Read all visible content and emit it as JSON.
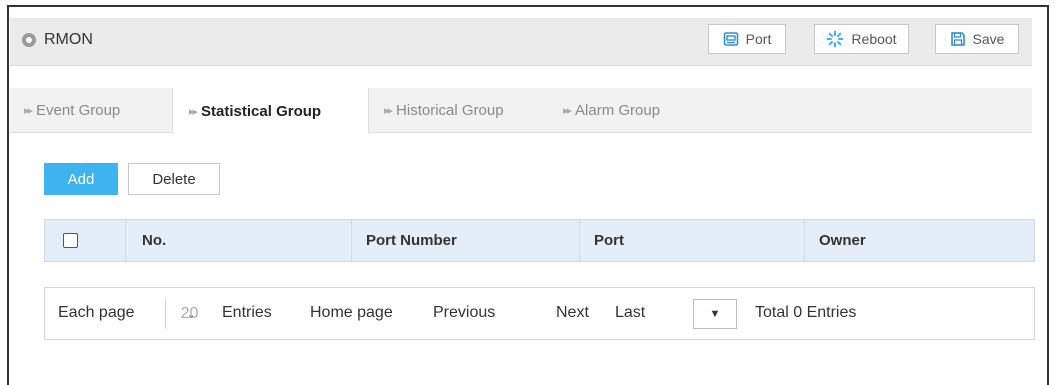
{
  "header": {
    "title": "RMON",
    "icon": "location-pin-icon",
    "buttons": {
      "port": "Port",
      "reboot": "Reboot",
      "save": "Save"
    }
  },
  "tabs": [
    {
      "label": "Event Group",
      "active": false
    },
    {
      "label": "Statistical Group",
      "active": true
    },
    {
      "label": "Historical Group",
      "active": false
    },
    {
      "label": "Alarm Group",
      "active": false
    }
  ],
  "actions": {
    "add": "Add",
    "delete": "Delete"
  },
  "table": {
    "columns": [
      "No.",
      "Port Number",
      "Port",
      "Owner"
    ],
    "rows": []
  },
  "pager": {
    "each_page_label": "Each page",
    "page_size": "20",
    "entries_label": "Entries",
    "home": "Home page",
    "previous": "Previous",
    "next": "Next",
    "last": "Last",
    "jump_value": "",
    "total": "Total 0 Entries"
  },
  "colors": {
    "accent": "#3db3ef",
    "header_bg": "#ebebeb",
    "table_header_bg": "#e3eef8"
  }
}
